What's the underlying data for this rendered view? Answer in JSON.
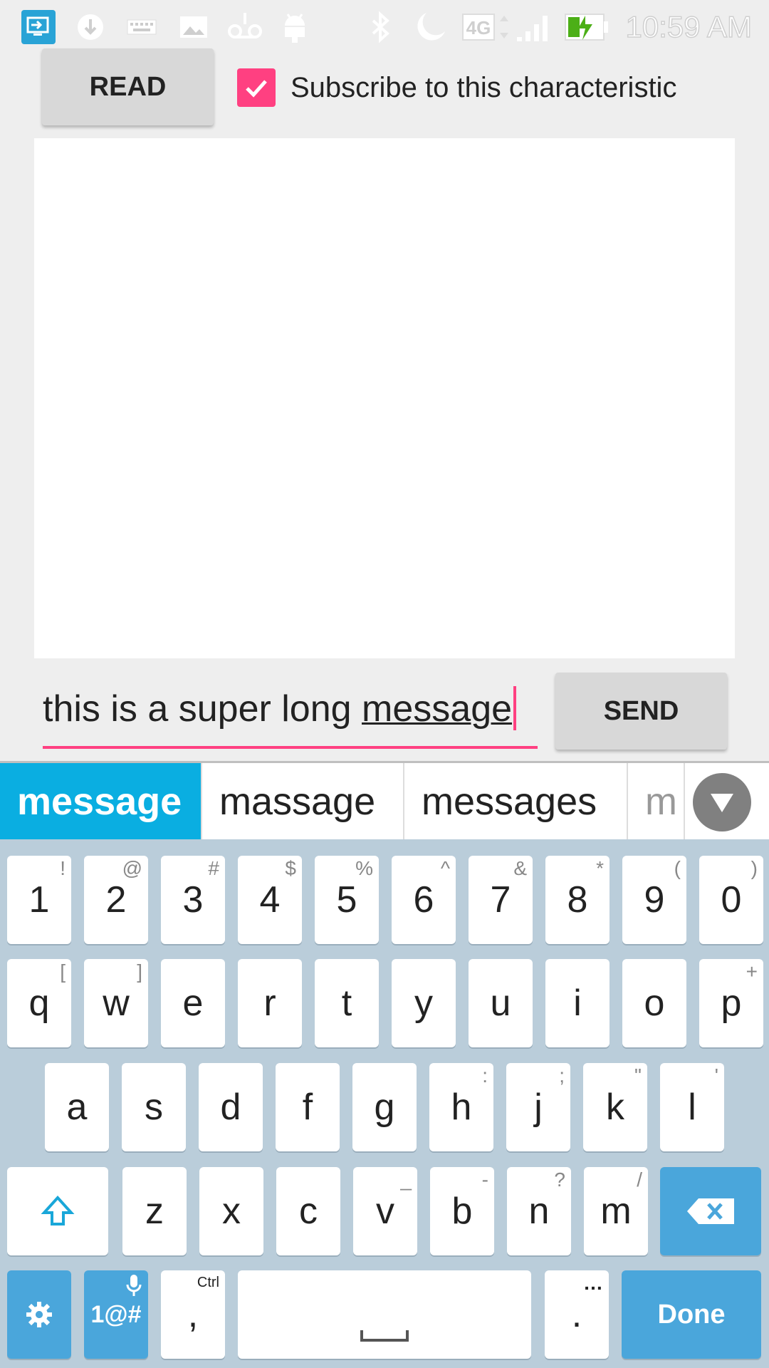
{
  "status_bar": {
    "time": "10:59 AM",
    "network": "4G",
    "icons": [
      "screen-share-icon",
      "download-icon",
      "keyboard-icon",
      "image-icon",
      "voicemail-icon",
      "android-icon",
      "bluetooth-icon",
      "do-not-disturb-moon-icon",
      "signal-icon",
      "battery-charging-icon"
    ]
  },
  "controls": {
    "read_label": "READ",
    "subscribe_label": "Subscribe to this characteristic",
    "subscribe_checked": true
  },
  "message": {
    "prefix": "this is a super long ",
    "composing": "message",
    "send_label": "SEND"
  },
  "keyboard": {
    "suggestions": [
      "message",
      "massage",
      "messages",
      "m"
    ],
    "row_numbers": [
      {
        "key": "1",
        "hint": "!"
      },
      {
        "key": "2",
        "hint": "@"
      },
      {
        "key": "3",
        "hint": "#"
      },
      {
        "key": "4",
        "hint": "$"
      },
      {
        "key": "5",
        "hint": "%"
      },
      {
        "key": "6",
        "hint": "^"
      },
      {
        "key": "7",
        "hint": "&"
      },
      {
        "key": "8",
        "hint": "*"
      },
      {
        "key": "9",
        "hint": "("
      },
      {
        "key": "0",
        "hint": ")"
      }
    ],
    "row_q": [
      {
        "key": "q",
        "hint": "["
      },
      {
        "key": "w",
        "hint": "]"
      },
      {
        "key": "e",
        "hint": ""
      },
      {
        "key": "r",
        "hint": ""
      },
      {
        "key": "t",
        "hint": ""
      },
      {
        "key": "y",
        "hint": ""
      },
      {
        "key": "u",
        "hint": ""
      },
      {
        "key": "i",
        "hint": ""
      },
      {
        "key": "o",
        "hint": ""
      },
      {
        "key": "p",
        "hint": "+"
      }
    ],
    "row_a": [
      {
        "key": "a",
        "hint": ""
      },
      {
        "key": "s",
        "hint": ""
      },
      {
        "key": "d",
        "hint": ""
      },
      {
        "key": "f",
        "hint": ""
      },
      {
        "key": "g",
        "hint": ""
      },
      {
        "key": "h",
        "hint": ":"
      },
      {
        "key": "j",
        "hint": ";"
      },
      {
        "key": "k",
        "hint": "\""
      },
      {
        "key": "l",
        "hint": "'"
      }
    ],
    "row_z": [
      {
        "key": "z",
        "hint": ""
      },
      {
        "key": "x",
        "hint": ""
      },
      {
        "key": "c",
        "hint": ""
      },
      {
        "key": "v",
        "hint": "_"
      },
      {
        "key": "b",
        "hint": "-"
      },
      {
        "key": "n",
        "hint": "?"
      },
      {
        "key": "m",
        "hint": "/"
      }
    ],
    "symbols_label": "1@#",
    "comma_label": ",",
    "comma_hint": "Ctrl",
    "period_label": ".",
    "period_hint": "…",
    "done_label": "Done",
    "colors": {
      "accent": "#0aaee1",
      "action_key": "#4aa6db",
      "background": "#bacdda",
      "pink": "#ff4081"
    }
  }
}
